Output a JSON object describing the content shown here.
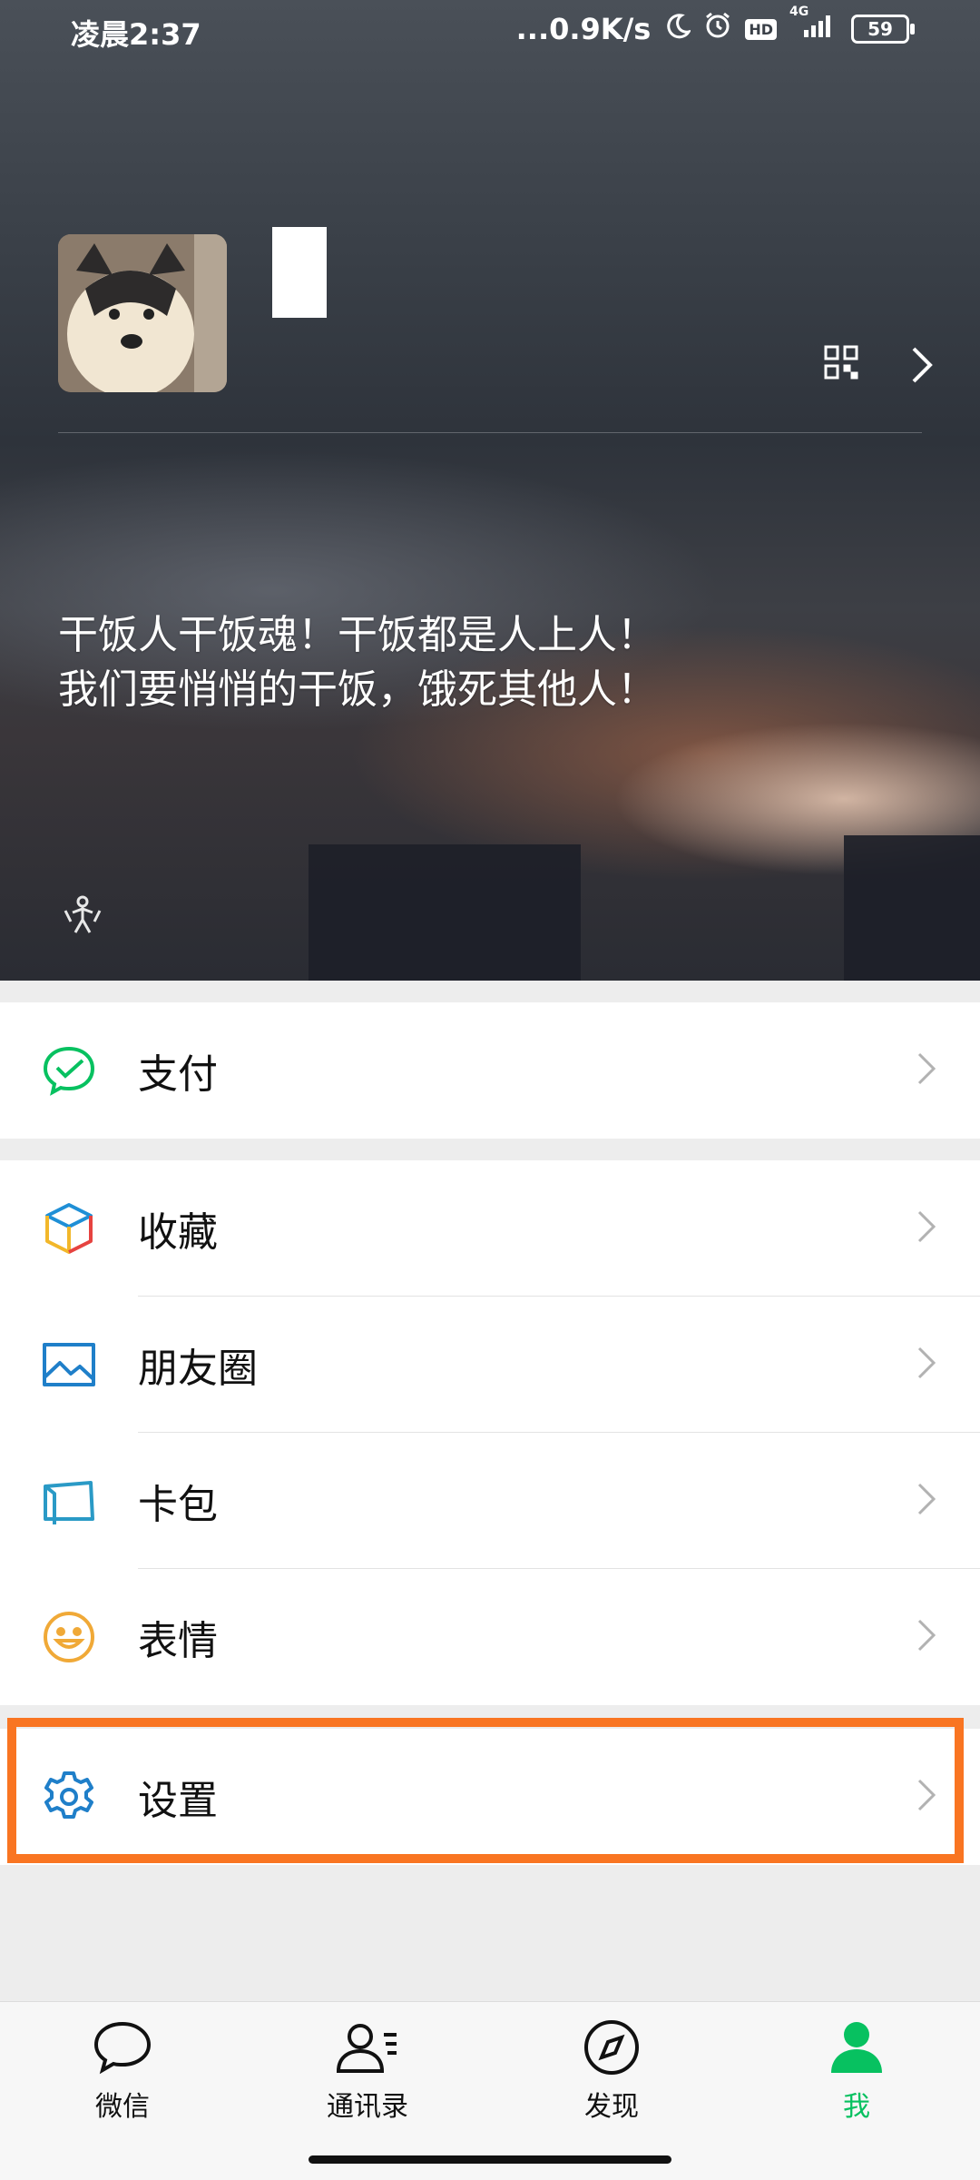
{
  "status_bar": {
    "time": "凌晨2:37",
    "network_speed": "...0.9K/s",
    "hd_badge": "HD",
    "network_type": "4G",
    "battery": "59"
  },
  "profile": {
    "signature_line1": "干饭人干饭魂！干饭都是人上人！",
    "signature_line2": "我们要悄悄的干饭，饿死其他人！"
  },
  "menu": {
    "pay": "支付",
    "favorites": "收藏",
    "moments": "朋友圈",
    "cards": "卡包",
    "stickers": "表情",
    "settings": "设置"
  },
  "bottom_nav": {
    "chats": "微信",
    "contacts": "通讯录",
    "discover": "发现",
    "me": "我"
  },
  "colors": {
    "accent_green": "#07c160",
    "highlight_orange": "#f97522"
  }
}
